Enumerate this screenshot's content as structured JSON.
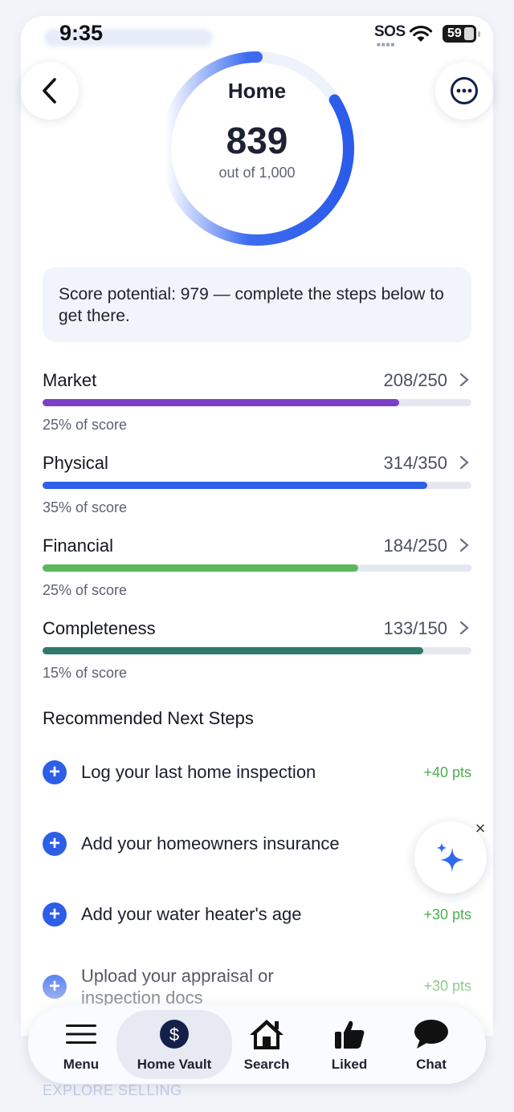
{
  "status_bar": {
    "time": "9:35",
    "sos": "SOS",
    "battery": "59"
  },
  "header": {
    "title": "Home",
    "score": "839",
    "out_of": "out of 1,000",
    "score_fraction": 0.839
  },
  "potential": {
    "text": "Score potential: 979 — complete the steps below to get there."
  },
  "categories": [
    {
      "name": "Market",
      "value": "208/250",
      "pct": "25% of score",
      "fraction": 0.832,
      "color": "#7b3fc6"
    },
    {
      "name": "Physical",
      "value": "314/350",
      "pct": "35% of score",
      "fraction": 0.897,
      "color": "#2f5fe6"
    },
    {
      "name": "Financial",
      "value": "184/250",
      "pct": "25% of score",
      "fraction": 0.736,
      "color": "#5cb85c"
    },
    {
      "name": "Completeness",
      "value": "133/150",
      "pct": "15% of score",
      "fraction": 0.887,
      "color": "#2e7a6b"
    }
  ],
  "next_steps": {
    "title": "Recommended Next Steps",
    "items": [
      {
        "label": "Log your last home inspection",
        "pts": "+40 pts"
      },
      {
        "label": "Add your homeowners insurance",
        "pts": ""
      },
      {
        "label": "Add your water heater's age",
        "pts": "+30 pts"
      },
      {
        "label": "Upload your appraisal or inspection docs",
        "pts": "+30 pts"
      }
    ]
  },
  "tabs": [
    {
      "label": "Menu",
      "icon": "menu-icon"
    },
    {
      "label": "Home Vault",
      "icon": "dollar-icon"
    },
    {
      "label": "Search",
      "icon": "house-icon"
    },
    {
      "label": "Liked",
      "icon": "thumbs-up-icon"
    },
    {
      "label": "Chat",
      "icon": "chat-bubble-icon"
    }
  ],
  "footer": {
    "explore": "EXPLORE SELLING"
  }
}
